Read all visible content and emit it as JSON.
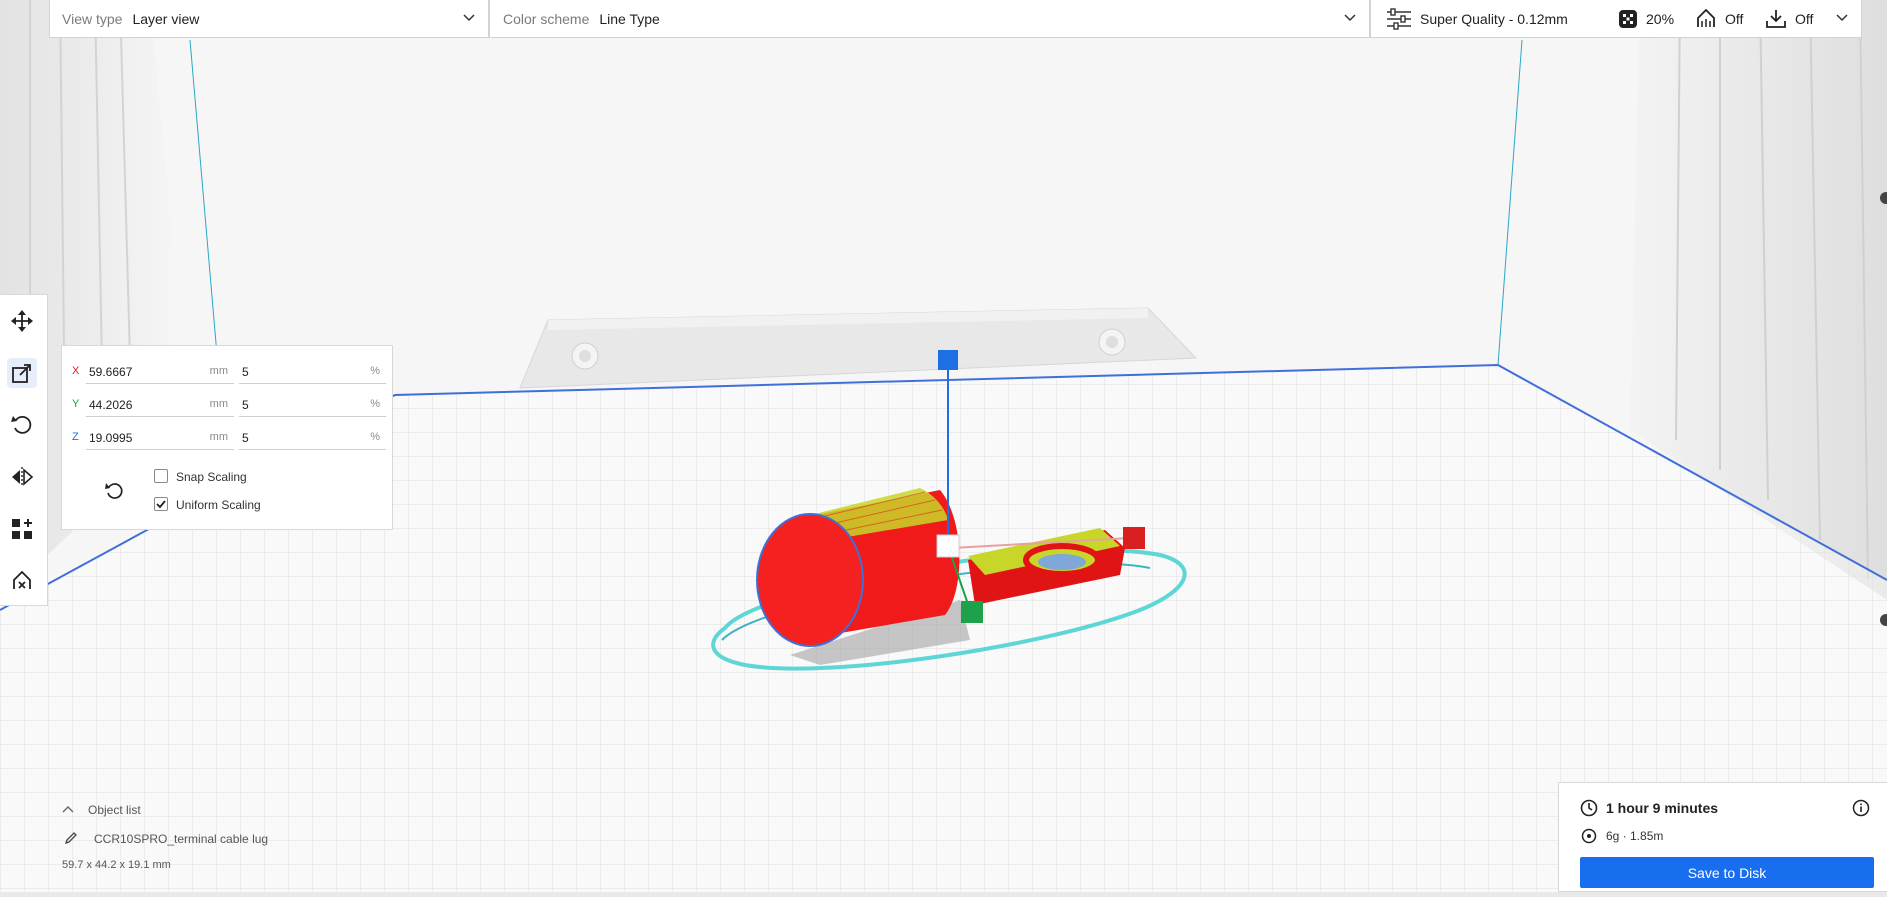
{
  "topbar": {
    "view_type_label": "View type",
    "view_type_value": "Layer view",
    "color_scheme_label": "Color scheme",
    "color_scheme_value": "Line Type",
    "profile": "Super Quality - 0.12mm",
    "infill": "20%",
    "support": "Off",
    "adhesion": "Off"
  },
  "toolbar": {
    "tools": [
      "move-tool",
      "scale-tool",
      "rotate-tool",
      "mirror-tool",
      "per-model-settings-tool",
      "support-blocker-tool"
    ],
    "active": "scale-tool"
  },
  "scale": {
    "x_label": "X",
    "x_mm": "59.6667",
    "x_pct": "5",
    "y_label": "Y",
    "y_mm": "44.2026",
    "y_pct": "5",
    "z_label": "Z",
    "z_mm": "19.0995",
    "z_pct": "5",
    "unit_mm": "mm",
    "unit_pct": "%",
    "snap_label": "Snap Scaling",
    "snap_checked": false,
    "uniform_label": "Uniform Scaling",
    "uniform_checked": true
  },
  "object_list": {
    "header": "Object list",
    "object_name": "CCR10SPRO_terminal cable lug",
    "dimensions": "59.7 x 44.2 x 19.1 mm"
  },
  "print": {
    "time": "1 hour 9 minutes",
    "material": "6g · 1.85m",
    "save_label": "Save to Disk"
  },
  "colors": {
    "accent": "#196ef0",
    "model_red": "#f01a1a",
    "infill_yellow": "#c8d62a",
    "axis_red": "#d92020",
    "axis_green": "#1fa04a",
    "axis_blue": "#1e6fe6",
    "skirt_cyan": "#5fd6d6"
  }
}
